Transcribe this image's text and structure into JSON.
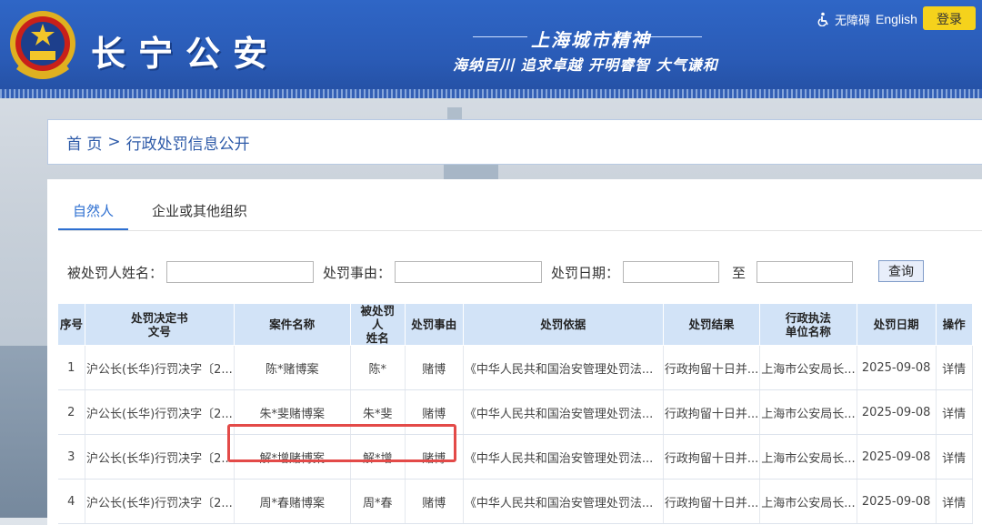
{
  "header": {
    "site_title": "长宁公安",
    "slogan_title": "上海城市精神",
    "slogan_text": "海纳百川 追求卓越 开明睿智 大气谦和",
    "accessibility_label": "无障碍",
    "english_label": "English",
    "login_label": "登录"
  },
  "breadcrumb": {
    "home": "首 页",
    "separator": ">",
    "current": "行政处罚信息公开"
  },
  "tabs": [
    {
      "label": "自然人",
      "active": true
    },
    {
      "label": "企业或其他组织",
      "active": false
    }
  ],
  "filters": {
    "name_label": "被处罚人姓名：",
    "reason_label": "处罚事由：",
    "date_label": "处罚日期：",
    "to_label": "至",
    "name_value": "",
    "reason_value": "",
    "date_from": "",
    "date_to": "",
    "search_label": "查询"
  },
  "table": {
    "headers": [
      "序号",
      "处罚决定书文号",
      "案件名称",
      "被处罚人姓名",
      "处罚事由",
      "处罚依据",
      "处罚结果",
      "行政执法单位名称",
      "处罚日期",
      "操作"
    ],
    "rows": [
      {
        "no": "1",
        "doc": "沪公长(长华)行罚决字〔2...",
        "case": "陈*赌博案",
        "person": "陈*",
        "reason": "赌博",
        "basis": "《中华人民共和国治安管理处罚法...",
        "result": "行政拘留十日并...",
        "unit": "上海市公安局长...",
        "date": "2025-09-08",
        "action": "详情"
      },
      {
        "no": "2",
        "doc": "沪公长(长华)行罚决字〔2...",
        "case": "朱*斐赌博案",
        "person": "朱*斐",
        "reason": "赌博",
        "basis": "《中华人民共和国治安管理处罚法...",
        "result": "行政拘留十日并...",
        "unit": "上海市公安局长...",
        "date": "2025-09-08",
        "action": "详情"
      },
      {
        "no": "3",
        "doc": "沪公长(长华)行罚决字〔2...",
        "case": "解*增赌博案",
        "person": "解*增",
        "reason": "赌博",
        "basis": "《中华人民共和国治安管理处罚法...",
        "result": "行政拘留十日并...",
        "unit": "上海市公安局长...",
        "date": "2025-09-08",
        "action": "详情"
      },
      {
        "no": "4",
        "doc": "沪公长(长华)行罚决字〔2...",
        "case": "周*春赌博案",
        "person": "周*春",
        "reason": "赌博",
        "basis": "《中华人民共和国治安管理处罚法...",
        "result": "行政拘留十日并...",
        "unit": "上海市公安局长...",
        "date": "2025-09-08",
        "action": "详情"
      }
    ]
  },
  "colors": {
    "header_blue": "#2f66c6",
    "login_yellow": "#f5d21c",
    "tab_active": "#2d6fd1",
    "table_header_bg": "#d2e3f7",
    "highlight_red": "#e34a48"
  }
}
